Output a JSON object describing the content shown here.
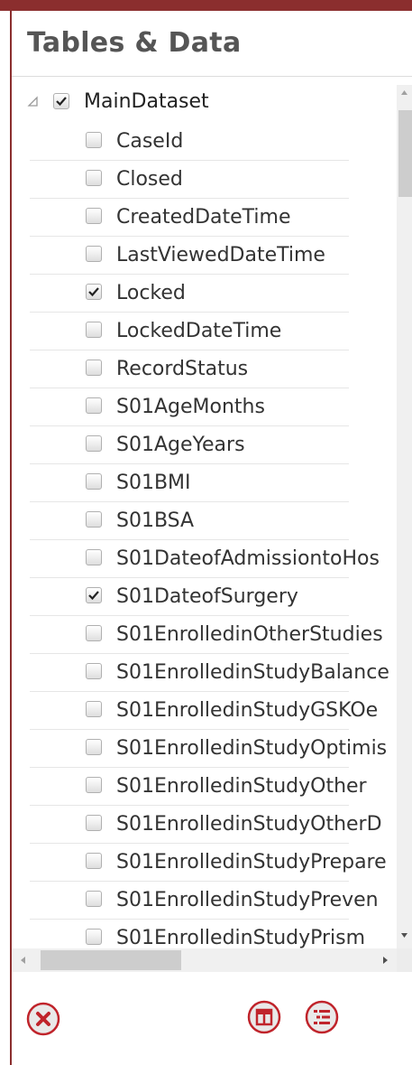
{
  "panel": {
    "title": "Tables & Data"
  },
  "tree": {
    "root": {
      "label": "MainDataset",
      "checked": true,
      "expanded": true
    },
    "fields": [
      {
        "label": "CaseId",
        "checked": false
      },
      {
        "label": "Closed",
        "checked": false
      },
      {
        "label": "CreatedDateTime",
        "checked": false
      },
      {
        "label": "LastViewedDateTime",
        "checked": false
      },
      {
        "label": "Locked",
        "checked": true
      },
      {
        "label": "LockedDateTime",
        "checked": false
      },
      {
        "label": "RecordStatus",
        "checked": false
      },
      {
        "label": "S01AgeMonths",
        "checked": false
      },
      {
        "label": "S01AgeYears",
        "checked": false
      },
      {
        "label": "S01BMI",
        "checked": false
      },
      {
        "label": "S01BSA",
        "checked": false
      },
      {
        "label": "S01DateofAdmissiontoHos",
        "checked": false
      },
      {
        "label": "S01DateofSurgery",
        "checked": true
      },
      {
        "label": "S01EnrolledinOtherStudies",
        "checked": false
      },
      {
        "label": "S01EnrolledinStudyBalance",
        "checked": false
      },
      {
        "label": "S01EnrolledinStudyGSKOe",
        "checked": false
      },
      {
        "label": "S01EnrolledinStudyOptimis",
        "checked": false
      },
      {
        "label": "S01EnrolledinStudyOther",
        "checked": false
      },
      {
        "label": "S01EnrolledinStudyOtherD",
        "checked": false
      },
      {
        "label": "S01EnrolledinStudyPrepare",
        "checked": false
      },
      {
        "label": "S01EnrolledinStudyPreven",
        "checked": false
      },
      {
        "label": "S01EnrolledinStudyPrism",
        "checked": false
      }
    ]
  },
  "footer": {
    "buttons": [
      {
        "icon": "close-circle-icon"
      },
      {
        "icon": "table-icon"
      },
      {
        "icon": "list-icon"
      }
    ]
  },
  "colors": {
    "accent": "#8b2e2e",
    "icon": "#c0242b"
  }
}
